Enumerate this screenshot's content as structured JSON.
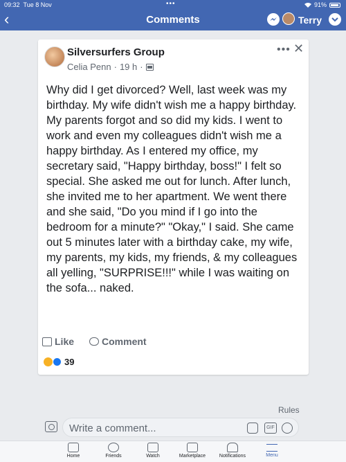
{
  "status_bar": {
    "time": "09:32",
    "date": "Tue 8 Nov",
    "dots": "•••",
    "battery": "91%"
  },
  "header": {
    "back_icon": "‹",
    "title": "Comments",
    "user": "Terry",
    "brand_color": "#4267b2"
  },
  "post": {
    "group_name": "Silversurfers Group",
    "author": "Celia Penn",
    "time": "19 h",
    "more_icon": "•••",
    "close_icon": "✕",
    "text": "Why did I get divorced? Well, last week was my birthday. My wife didn't wish me a happy birthday. My parents forgot and so did my kids. I went to work and even my colleagues didn't wish me a happy birthday. As I entered my office, my secretary said, \"Happy birthday, boss!\" I felt so special. She asked me out for lunch. After lunch, she invited me to her apartment. We went there and she said, \"Do you mind if I go into the bedroom for a minute?\" \"Okay,\" I said. She came out 5 minutes later with a birthday cake, my wife, my parents, my kids, my friends, & my colleagues all yelling, \"SURPRISE!!!\" while I was waiting on the sofa... naked.",
    "like_label": "Like",
    "comment_label": "Comment",
    "reaction_count": "39"
  },
  "comment_area": {
    "rules_label": "Rules",
    "placeholder": "Write a comment...",
    "gif_label": "GIF"
  },
  "tabs": [
    {
      "label": "Home"
    },
    {
      "label": "Friends"
    },
    {
      "label": "Watch"
    },
    {
      "label": "Marketplace"
    },
    {
      "label": "Notifications"
    },
    {
      "label": "Menu"
    }
  ]
}
